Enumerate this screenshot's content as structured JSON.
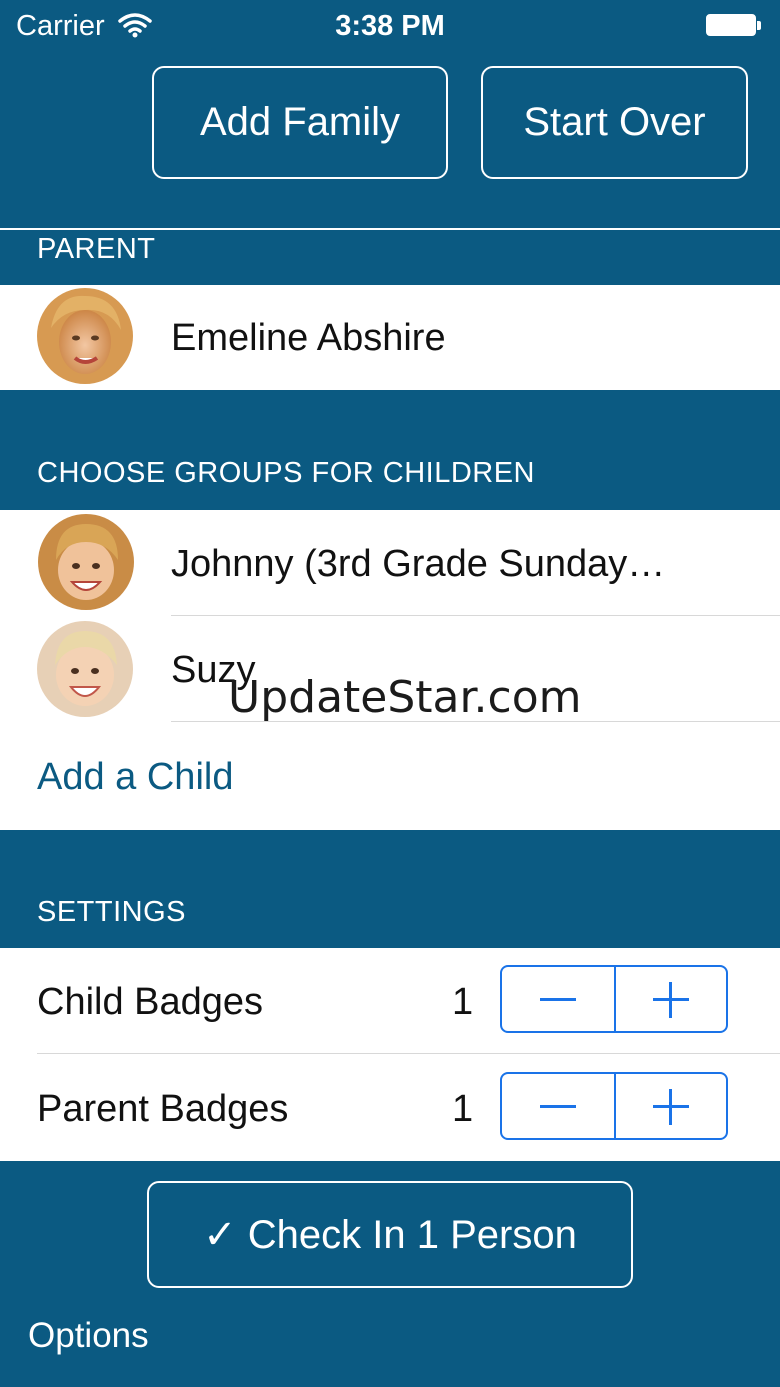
{
  "status_bar": {
    "carrier": "Carrier",
    "time": "3:38 PM"
  },
  "header": {
    "add_family": "Add Family",
    "start_over": "Start Over"
  },
  "parent_section": {
    "title": "PARENT",
    "parent_name": "Emeline Abshire"
  },
  "children_section": {
    "title": "CHOOSE GROUPS FOR CHILDREN",
    "children": [
      {
        "name": "Johnny (3rd Grade Sunday…"
      },
      {
        "name": "Suzy"
      }
    ],
    "add_child": "Add a Child"
  },
  "settings_section": {
    "title": "SETTINGS",
    "rows": [
      {
        "label": "Child Badges",
        "count": "1"
      },
      {
        "label": "Parent Badges",
        "count": "1"
      }
    ]
  },
  "footer": {
    "check_in": "✓  Check In 1 Person",
    "options": "Options"
  },
  "watermark": "UpdateStar.com",
  "colors": {
    "brand_blue": "#0b5a82",
    "stepper_blue": "#1a73e8"
  }
}
